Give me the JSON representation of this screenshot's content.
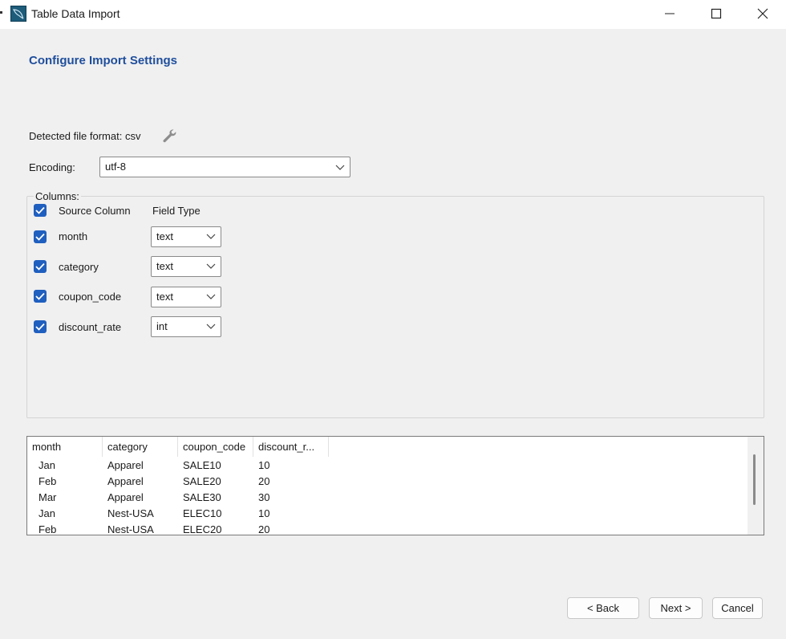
{
  "window": {
    "title": "Table Data Import"
  },
  "page": {
    "heading": "Configure Import Settings",
    "format_label": "Detected file format: csv",
    "encoding_label": "Encoding:",
    "encoding_value": "utf-8"
  },
  "columns": {
    "legend": "Columns:",
    "header_source": "Source Column",
    "header_type": "Field Type",
    "rows": [
      {
        "name": "month",
        "type": "text",
        "checked": true
      },
      {
        "name": "category",
        "type": "text",
        "checked": true
      },
      {
        "name": "coupon_code",
        "type": "text",
        "checked": true
      },
      {
        "name": "discount_rate",
        "type": "int",
        "checked": true
      }
    ]
  },
  "preview": {
    "headers": [
      "month",
      "category",
      "coupon_code",
      "discount_r..."
    ],
    "rows": [
      [
        "Jan",
        "Apparel",
        "SALE10",
        "10"
      ],
      [
        "Feb",
        "Apparel",
        "SALE20",
        "20"
      ],
      [
        "Mar",
        "Apparel",
        "SALE30",
        "30"
      ],
      [
        "Jan",
        "Nest-USA",
        "ELEC10",
        "10"
      ],
      [
        "Feb",
        "Nest-USA",
        "ELEC20",
        "20"
      ]
    ]
  },
  "buttons": {
    "back": "< Back",
    "next": "Next >",
    "cancel": "Cancel"
  },
  "colors": {
    "heading": "#1f4e9c",
    "checkbox": "#1f5fbf"
  },
  "icons": {
    "app": "mysql-dolphin-icon",
    "wrench": "wrench-icon",
    "minimize": "minimize-icon",
    "maximize": "maximize-icon",
    "close": "close-icon",
    "dropdown": "chevron-down-icon",
    "check": "checkmark-icon"
  }
}
